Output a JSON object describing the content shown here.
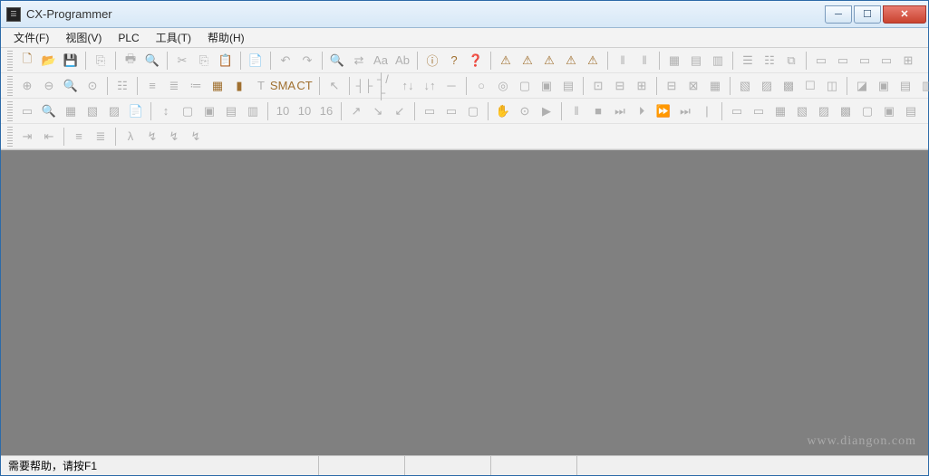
{
  "window": {
    "title": "CX-Programmer"
  },
  "menu": {
    "file": "文件(F)",
    "view": "视图(V)",
    "plc": "PLC",
    "tool": "工具(T)",
    "help": "帮助(H)"
  },
  "statusbar": {
    "help_text": "需要帮助，请按F1"
  },
  "watermark": "www.diangon.com",
  "icons": {
    "new": "new-file-icon",
    "open": "open-folder-icon",
    "save": "save-icon",
    "print": "print-icon",
    "preview": "print-preview-icon",
    "cut": "cut-icon",
    "copy": "copy-icon",
    "paste": "paste-icon",
    "undo": "undo-icon",
    "redo": "redo-icon",
    "find": "find-icon",
    "replace": "replace-icon",
    "info": "info-icon",
    "help": "help-icon",
    "context": "context-help-icon",
    "zoomin": "zoom-in-icon",
    "zoomout": "zoom-out-icon",
    "contact_no": "contact-no-icon",
    "contact_nc": "contact-nc-icon",
    "coil": "coil-icon",
    "line_h": "line-horizontal-icon",
    "line_v": "line-vertical-icon",
    "play": "run-icon",
    "pause": "pause-icon",
    "stop": "stop-icon",
    "step": "step-icon",
    "next": "next-icon",
    "ff": "fast-forward-icon",
    "indent": "indent-icon",
    "outdent": "outdent-icon",
    "align_l": "align-left-icon",
    "align_j": "align-justify-icon"
  },
  "row1_labels": [
    "new",
    "open",
    "save",
    "save2",
    "print",
    "preview",
    "cut",
    "copy",
    "paste",
    "paste2",
    "undo",
    "redo",
    "find",
    "replace",
    "find2",
    "find3",
    "info",
    "help",
    "context",
    "warn1",
    "warn2",
    "warn3",
    "warn4",
    "warn5",
    "pause1",
    "pause2",
    "grid1",
    "grid2",
    "grid3",
    "net1",
    "net2",
    "net3",
    "tab1",
    "tab2",
    "tab3",
    "tab4",
    "tab5"
  ],
  "row2_labels": [
    "zoom1",
    "zoom2",
    "zoom3",
    "zoom4",
    "s1",
    "list1",
    "list2",
    "list3",
    "grid",
    "bar",
    "text",
    "sma",
    "ct",
    "cursor",
    "c1",
    "c2",
    "c3",
    "c4",
    "line",
    "coil1",
    "coil2",
    "block1",
    "block2",
    "block3",
    "box1",
    "box2",
    "g1",
    "g2",
    "g3",
    "w1",
    "w2",
    "w3",
    "w4",
    "w5",
    "view1",
    "view2",
    "view3",
    "view4",
    "view5"
  ],
  "row3_labels": [
    "m1",
    "m2",
    "m3",
    "m4",
    "m5",
    "m6",
    "t1",
    "t2",
    "t3",
    "t4",
    "t5",
    "d10",
    "d10b",
    "d16",
    "a1",
    "a2",
    "a3",
    "r1",
    "r2",
    "r3",
    "h1",
    "h2",
    "play",
    "pause",
    "stop",
    "step",
    "next",
    "ff1",
    "ff2",
    "sep",
    "p1",
    "p2",
    "p3",
    "p4",
    "p5",
    "p6",
    "p7",
    "p8",
    "p9"
  ],
  "row4_labels": [
    "indent",
    "outdent",
    "align1",
    "align2",
    "f1",
    "f2",
    "f3",
    "f4"
  ]
}
